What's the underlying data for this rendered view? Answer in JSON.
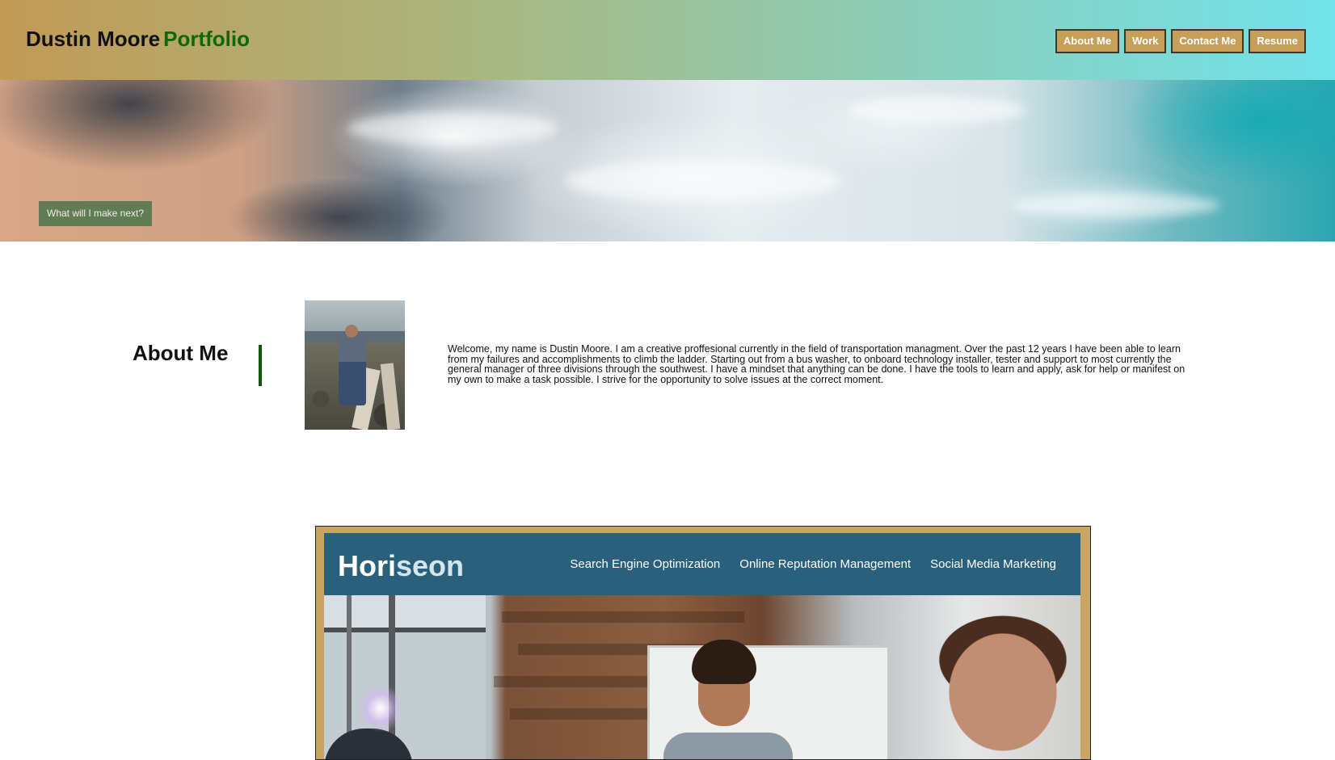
{
  "header": {
    "brand_name": "Dustin Moore",
    "brand_suffix": "Portfolio",
    "nav": [
      {
        "label": "About Me"
      },
      {
        "label": "Work"
      },
      {
        "label": "Contact Me"
      },
      {
        "label": "Resume"
      }
    ]
  },
  "hero": {
    "cta_label": "What will I make next?"
  },
  "about": {
    "title": "About Me",
    "bio": "Welcome, my name is Dustin Moore. I am a creative proffesional currently in the field of transportation managment. Over the past 12 years I have been able to learn from my failures and accomplishments to climb the ladder. Starting out from a bus washer, to onboard technology installer, tester and support to most currently the general manager of three divisions through the southwest. I have a mindset that anything can be done. I have the tools to learn and apply, ask for help or manifest on my own to make a task possible. I strive for the opportunity to solve issues at the correct moment."
  },
  "project": {
    "logo_prefix": "Hori",
    "logo_suffix": "seon",
    "links": [
      {
        "label": "Search Engine Optimization"
      },
      {
        "label": "Online Reputation Management"
      },
      {
        "label": "Social Media Marketing"
      }
    ]
  },
  "colors": {
    "header_gradient_start": "#c19a55",
    "header_gradient_end": "#72e2ea",
    "nav_button": "#c6a05a",
    "brand_accent": "#0a6a0a",
    "cta_background": "#5f7c55",
    "divider": "#0a5a0a",
    "project_frame": "#c9a563",
    "horiseon_bar": "#2a607c"
  }
}
